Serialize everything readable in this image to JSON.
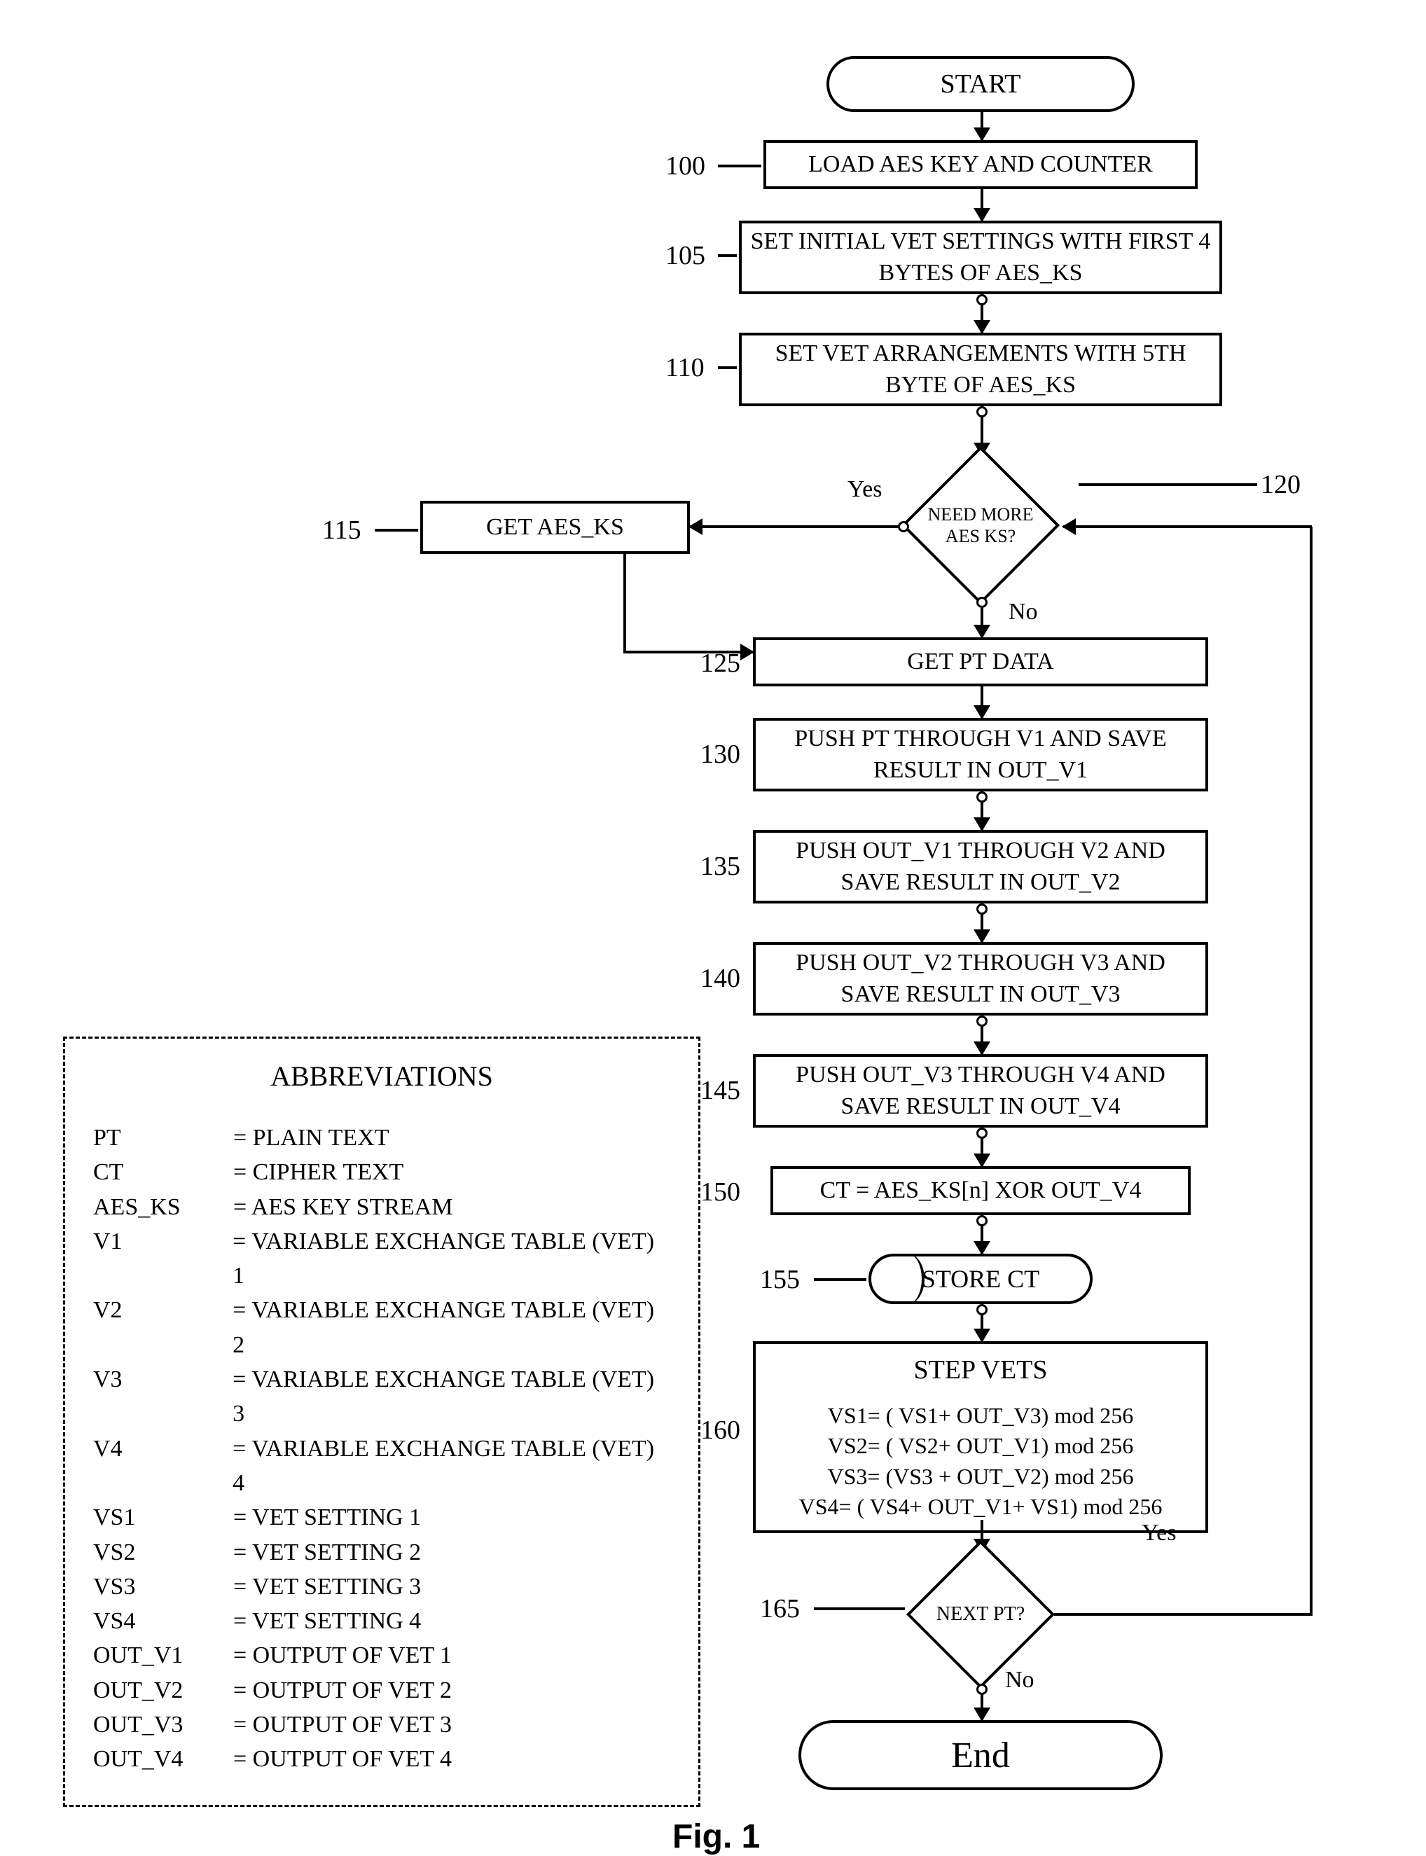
{
  "fig_label": "Fig. 1",
  "terminals": {
    "start": "START",
    "end": "End"
  },
  "steps": {
    "s100": "LOAD AES KEY AND COUNTER",
    "s105": "SET INITIAL VET SETTINGS WITH FIRST 4 BYTES OF  AES_KS",
    "s110": "SET VET ARRANGEMENTS WITH 5TH BYTE OF AES_KS",
    "s115": "GET AES_KS",
    "s120": "NEED MORE AES KS?",
    "s125": "GET PT DATA",
    "s130": "PUSH PT THROUGH V1 AND SAVE RESULT IN OUT_V1",
    "s135": "PUSH OUT_V1 THROUGH V2 AND SAVE RESULT IN OUT_V2",
    "s140": "PUSH OUT_V2 THROUGH V3 AND SAVE RESULT IN OUT_V3",
    "s145": "PUSH OUT_V3 THROUGH V4 AND SAVE RESULT IN OUT_V4",
    "s150": "CT = AES_KS[n] XOR OUT_V4",
    "s155": "STORE CT",
    "s160_title": "STEP VETS",
    "s160_body": "VS1= ( VS1+ OUT_V3) mod 256\nVS2= ( VS2+ OUT_V1) mod 256\nVS3= (VS3 + OUT_V2) mod 256\nVS4= ( VS4+ OUT_V1+ VS1) mod 256",
    "s165": "NEXT PT?"
  },
  "refs": {
    "r100": "100",
    "r105": "105",
    "r110": "110",
    "r115": "115",
    "r120": "120",
    "r125": "125",
    "r130": "130",
    "r135": "135",
    "r140": "140",
    "r145": "145",
    "r150": "150",
    "r155": "155",
    "r160": "160",
    "r165": "165"
  },
  "labels": {
    "yes": "Yes",
    "no": "No"
  },
  "abbr": {
    "heading": "ABBREVIATIONS",
    "rows": [
      {
        "k": "PT",
        "v": "= PLAIN TEXT"
      },
      {
        "k": "CT",
        "v": "= CIPHER TEXT"
      },
      {
        "k": "AES_KS",
        "v": "= AES KEY STREAM"
      },
      {
        "k": "V1",
        "v": "= VARIABLE EXCHANGE TABLE (VET) 1"
      },
      {
        "k": "V2",
        "v": "= VARIABLE EXCHANGE TABLE (VET) 2"
      },
      {
        "k": "V3",
        "v": "= VARIABLE EXCHANGE TABLE (VET) 3"
      },
      {
        "k": "V4",
        "v": "= VARIABLE EXCHANGE TABLE (VET) 4"
      },
      {
        "k": "VS1",
        "v": "= VET SETTING 1"
      },
      {
        "k": "VS2",
        "v": "= VET SETTING 2"
      },
      {
        "k": "VS3",
        "v": "= VET SETTING 3"
      },
      {
        "k": "VS4",
        "v": "= VET SETTING 4"
      },
      {
        "k": "OUT_V1",
        "v": "= OUTPUT OF VET 1"
      },
      {
        "k": "OUT_V2",
        "v": "= OUTPUT OF VET 2"
      },
      {
        "k": "OUT_V3",
        "v": "= OUTPUT OF VET 3"
      },
      {
        "k": "OUT_V4",
        "v": "= OUTPUT OF VET 4"
      }
    ]
  }
}
